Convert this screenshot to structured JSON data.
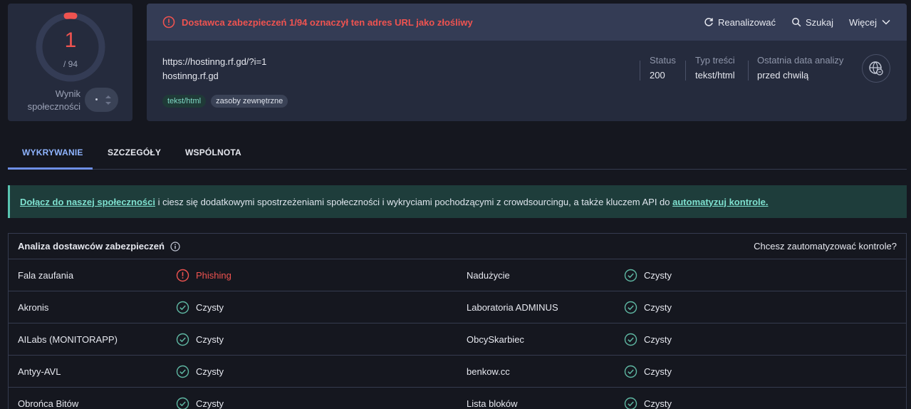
{
  "score": {
    "detections": "1",
    "total": "/ 94",
    "community_label": "Wynik społeczności"
  },
  "alert": {
    "text": "Dostawca zabezpieczeń 1/94 oznaczył ten adres URL jako złośliwy"
  },
  "actions": {
    "reanalyze": "Reanalizować",
    "search": "Szukaj",
    "more": "Więcej"
  },
  "url": {
    "full": "https://hostinng.rf.gd/?i=1",
    "host": "hostinng.rf.gd"
  },
  "tags": [
    "tekst/html",
    "zasoby zewnętrzne"
  ],
  "meta": {
    "status_label": "Status",
    "status_value": "200",
    "content_type_label": "Typ treści",
    "content_type_value": "tekst/html",
    "last_analysis_label": "Ostatnia data analizy",
    "last_analysis_value": "przed chwilą"
  },
  "tabs": [
    "WYKRYWANIE",
    "SZCZEGÓŁY",
    "WSPÓLNOTA"
  ],
  "banner": {
    "link1": "Dołącz do naszej społeczności",
    "middle": " i ciesz się dodatkowymi spostrzeżeniami społeczności i wykryciami pochodzącymi z crowdsourcingu, a także kluczem API do ",
    "link2": "automatyzuj kontrole."
  },
  "table": {
    "title": "Analiza dostawców zabezpieczeń",
    "automate": "Chcesz zautomatyzować kontrole?",
    "rows": [
      {
        "left_name": "Fala zaufania",
        "left_verdict": "Phishing",
        "left_bad": true,
        "right_name": "Nadużycie",
        "right_verdict": "Czysty"
      },
      {
        "left_name": "Akronis",
        "left_verdict": "Czysty",
        "right_name": "Laboratoria ADMINUS",
        "right_verdict": "Czysty"
      },
      {
        "left_name": "AILabs (MONITORAPP)",
        "left_verdict": "Czysty",
        "right_name": "ObcySkarbiec",
        "right_verdict": "Czysty"
      },
      {
        "left_name": "Antyy-AVL",
        "left_verdict": "Czysty",
        "right_name": "benkow.cc",
        "right_verdict": "Czysty"
      },
      {
        "left_name": "Obrońca Bitów",
        "left_verdict": "Czysty",
        "right_name": "Lista bloków",
        "right_verdict": "Czysty"
      }
    ]
  },
  "colors": {
    "malicious": "#ef5350",
    "clean": "#5fb8a3",
    "accent": "#8fb4ff"
  }
}
